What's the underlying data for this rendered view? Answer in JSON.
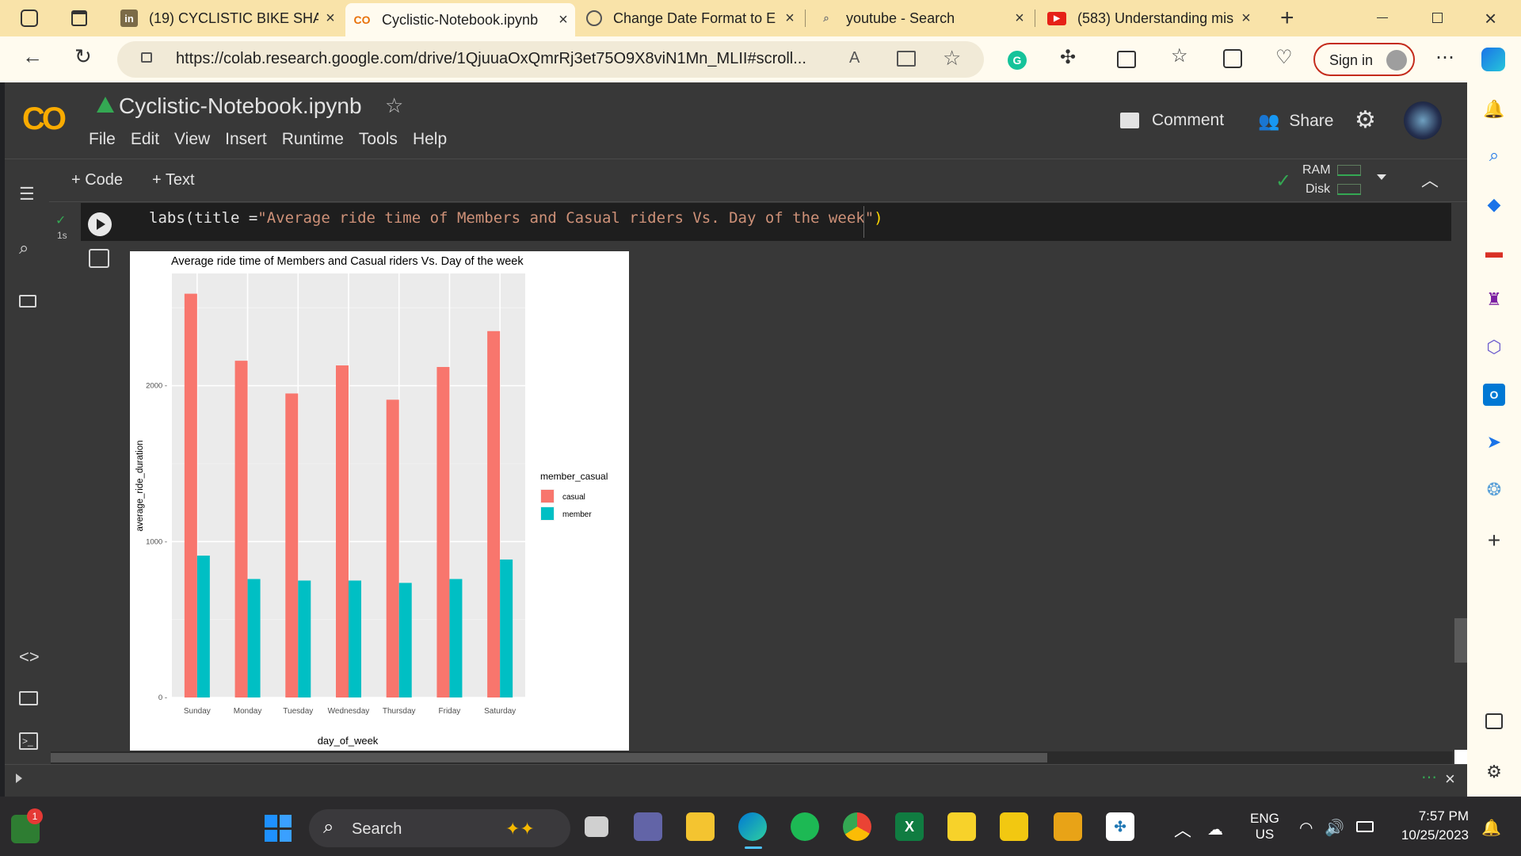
{
  "browser": {
    "tabs": [
      {
        "label": "(19) CYCLISTIC BIKE SHA",
        "icon": "linkedin-icon",
        "active": false
      },
      {
        "label": "Cyclistic-Notebook.ipynb",
        "icon": "colab-icon",
        "active": true
      },
      {
        "label": "Change Date Format to E",
        "icon": "chatgpt-icon",
        "active": false
      },
      {
        "label": "youtube - Search",
        "icon": "search-icon",
        "active": false
      },
      {
        "label": "(583) Understanding mis",
        "icon": "youtube-icon",
        "active": false
      }
    ],
    "url": "https://colab.research.google.com/drive/1QjuuaOxQmrRj3et75O9X8viN1Mn_MLII#scroll...",
    "sign_in": "Sign in"
  },
  "colab": {
    "logo": "CO",
    "notebook_title": "Cyclistic-Notebook.ipynb",
    "menu": [
      "File",
      "Edit",
      "View",
      "Insert",
      "Runtime",
      "Tools",
      "Help"
    ],
    "comment": "Comment",
    "share": "Share",
    "add_code": "+ Code",
    "add_text": "+ Text",
    "ram": "RAM",
    "disk": "Disk",
    "exec_time": "1s",
    "code_prefix": "labs(title =",
    "code_string": "\"Average ride time of Members and Casual riders Vs. Day of the week\"",
    "code_suffix": ")"
  },
  "chart_data": {
    "type": "bar",
    "title": "Average ride time of Members and Casual riders Vs. Day of the week",
    "xlabel": "day_of_week",
    "ylabel": "average_ride_duration",
    "categories": [
      "Sunday",
      "Monday",
      "Tuesday",
      "Wednesday",
      "Thursday",
      "Friday",
      "Saturday"
    ],
    "series": [
      {
        "name": "casual",
        "color": "#f8766d",
        "values": [
          2590,
          2160,
          1950,
          2130,
          1910,
          2120,
          2350
        ]
      },
      {
        "name": "member",
        "color": "#00bfc4",
        "values": [
          910,
          760,
          750,
          750,
          735,
          760,
          885
        ]
      }
    ],
    "ylim": [
      0,
      2720
    ],
    "yticks": [
      0,
      1000,
      2000
    ],
    "legend_title": "member_casual",
    "legend_position": "right",
    "grid": true
  },
  "taskbar": {
    "search": "Search",
    "lang_top": "ENG",
    "lang_bottom": "US",
    "time": "7:57 PM",
    "date": "10/25/2023",
    "notif_count": "1"
  }
}
